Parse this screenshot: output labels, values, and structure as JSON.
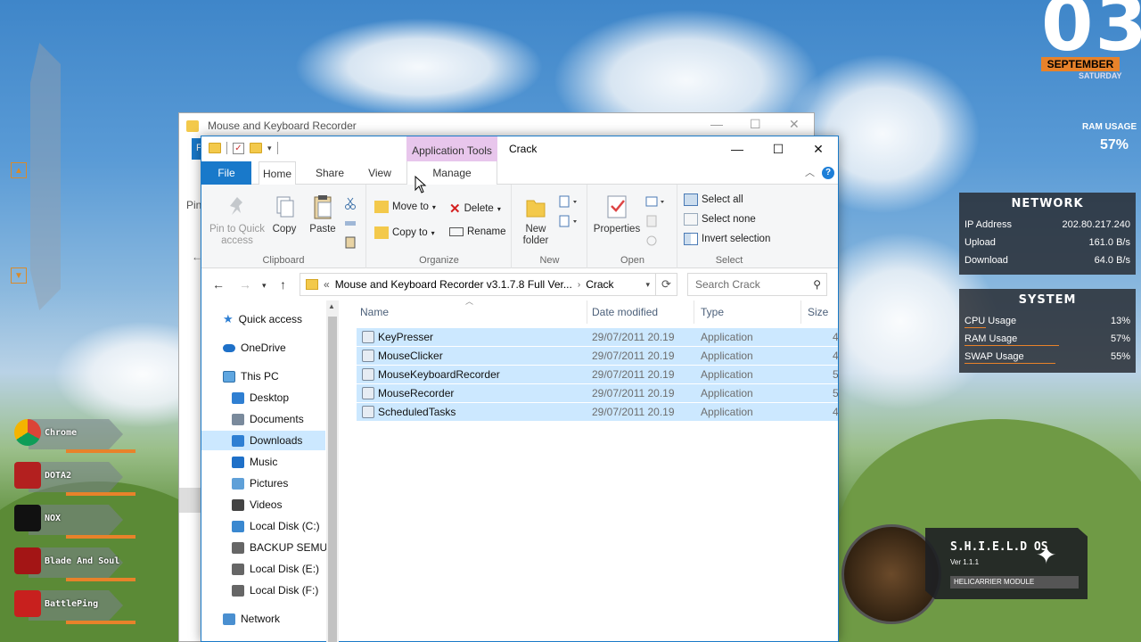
{
  "colors": {
    "accent": "#1979ca",
    "selection": "#cce8ff",
    "context_tab": "#e8c6ec",
    "widget_orange": "#e8822a"
  },
  "desktop": {
    "launchers": [
      {
        "label": "Chrome",
        "icon": "chrome-icon"
      },
      {
        "label": "DOTA2",
        "icon": "dota2-icon"
      },
      {
        "label": "NOX",
        "icon": "nox-icon"
      },
      {
        "label": "Blade And Soul",
        "icon": "blade-and-soul-icon"
      },
      {
        "label": "BattlePing",
        "icon": "battleping-icon"
      }
    ],
    "clock": {
      "day": "03",
      "month": "SEPTEMBER",
      "weekday": "SATURDAY"
    },
    "ram": {
      "label": "RAM USAGE",
      "value": "57%"
    },
    "network": {
      "title": "NETWORK",
      "rows": [
        {
          "label": "IP Address",
          "value": "202.80.217.240"
        },
        {
          "label": "Upload",
          "value": "161.0 B/s"
        },
        {
          "label": "Download",
          "value": "64.0 B/s"
        }
      ]
    },
    "system": {
      "title": "SYSTEM",
      "rows": [
        {
          "label": "CPU Usage",
          "value": "13%",
          "level": 0.13
        },
        {
          "label": "RAM Usage",
          "value": "57%",
          "level": 0.57
        },
        {
          "label": "SWAP Usage",
          "value": "55%",
          "level": 0.55
        }
      ]
    },
    "shield": {
      "title": "S.H.I.E.L.D OS",
      "version": "Ver 1.1.1",
      "module": "HELICARRIER MODULE"
    }
  },
  "bg_window": {
    "title": "Mouse and Keyboard Recorder",
    "file_tab": "F",
    "pin_label": "Pin"
  },
  "window": {
    "title": "Crack",
    "context_tab": "Application Tools",
    "tabs": {
      "file": "File",
      "home": "Home",
      "share": "Share",
      "view": "View",
      "manage": "Manage"
    },
    "ribbon": {
      "clipboard": {
        "label": "Clipboard",
        "pin": "Pin to Quick access",
        "copy": "Copy",
        "paste": "Paste"
      },
      "organize": {
        "label": "Organize",
        "move_to": "Move to",
        "copy_to": "Copy to",
        "delete": "Delete",
        "rename": "Rename"
      },
      "new": {
        "label": "New",
        "new_folder": "New folder"
      },
      "open": {
        "label": "Open",
        "properties": "Properties"
      },
      "select": {
        "label": "Select",
        "select_all": "Select all",
        "select_none": "Select none",
        "invert": "Invert selection"
      }
    },
    "address": {
      "prefix": "«",
      "crumbs": [
        "Mouse and Keyboard Recorder v3.1.7.8 Full Ver...",
        "Crack"
      ],
      "search_placeholder": "Search Crack"
    },
    "nav": {
      "quick_access": "Quick access",
      "onedrive": "OneDrive",
      "this_pc": "This PC",
      "items": [
        "Desktop",
        "Documents",
        "Downloads",
        "Music",
        "Pictures",
        "Videos",
        "Local Disk (C:)",
        "BACKUP SEMUA",
        "Local Disk (E:)",
        "Local Disk (F:)"
      ],
      "selected": "Downloads",
      "network": "Network"
    },
    "columns": {
      "name": "Name",
      "date": "Date modified",
      "type": "Type",
      "size": "Size"
    },
    "files": [
      {
        "name": "KeyPresser",
        "date": "29/07/2011 20.19",
        "type": "Application",
        "size": "4"
      },
      {
        "name": "MouseClicker",
        "date": "29/07/2011 20.19",
        "type": "Application",
        "size": "4"
      },
      {
        "name": "MouseKeyboardRecorder",
        "date": "29/07/2011 20.19",
        "type": "Application",
        "size": "5"
      },
      {
        "name": "MouseRecorder",
        "date": "29/07/2011 20.19",
        "type": "Application",
        "size": "5"
      },
      {
        "name": "ScheduledTasks",
        "date": "29/07/2011 20.19",
        "type": "Application",
        "size": "4"
      }
    ]
  }
}
